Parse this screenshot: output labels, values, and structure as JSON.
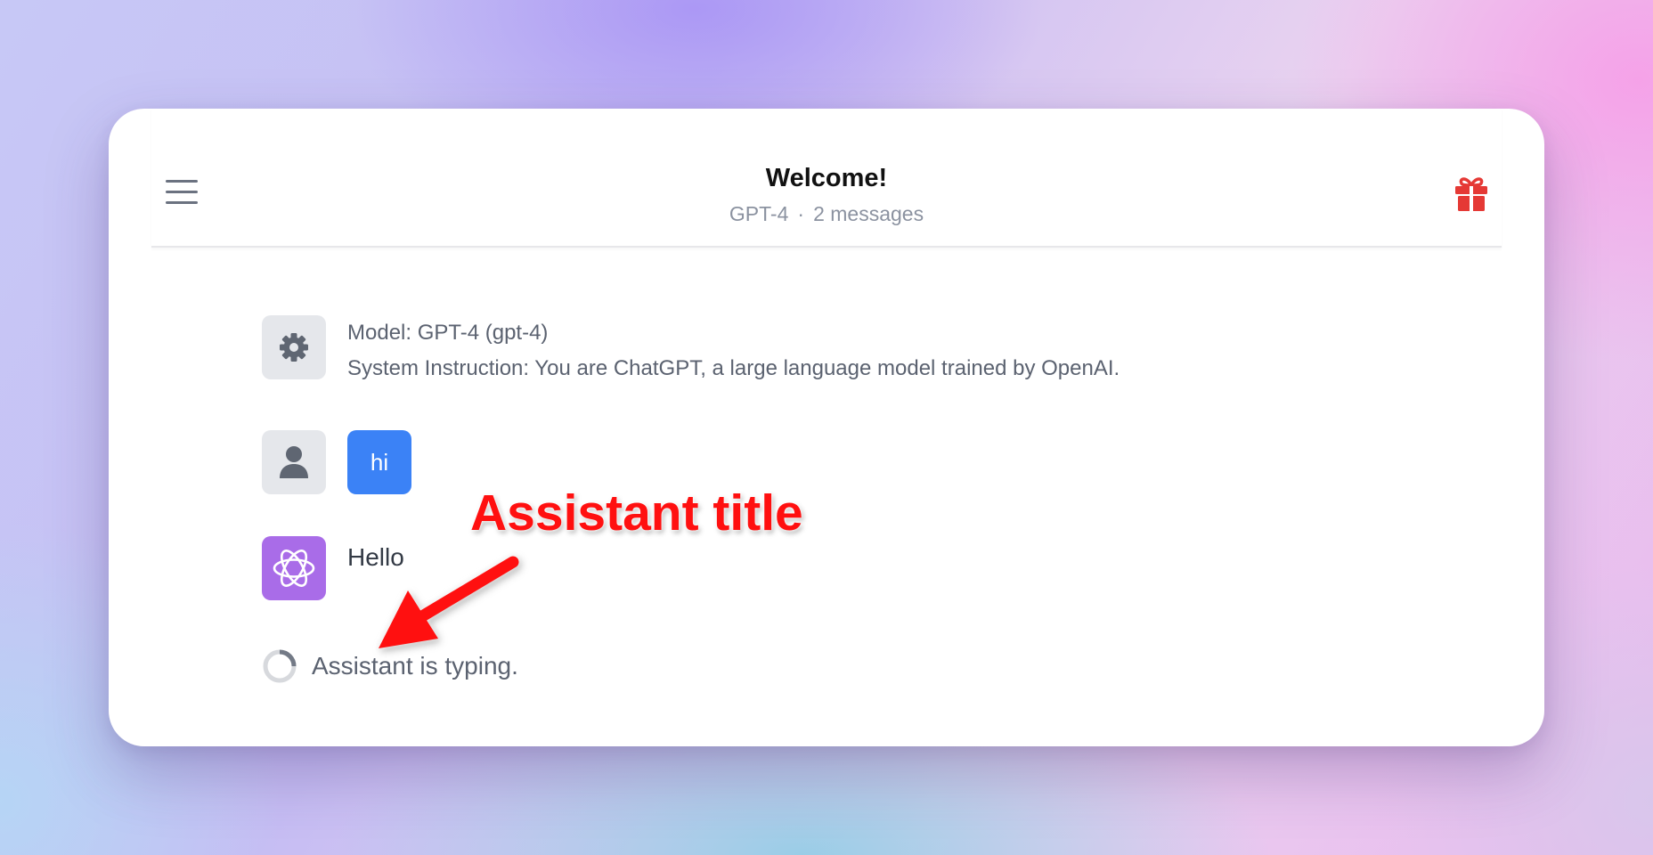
{
  "header": {
    "title": "Welcome!",
    "model": "GPT-4",
    "separator": "·",
    "message_count": "2 messages"
  },
  "icons": {
    "menu": "hamburger-menu-icon",
    "gift": "gift-icon",
    "system": "gear-icon",
    "user": "user-icon",
    "assistant": "openai-logo-icon",
    "loading": "spinner-icon"
  },
  "messages": {
    "system": {
      "model_line": "Model: GPT-4 (gpt-4)",
      "instruction": "System Instruction: You are ChatGPT, a large language model trained by OpenAI."
    },
    "user": {
      "text": "hi"
    },
    "assistant": {
      "text": "Hello"
    },
    "typing": "Assistant is typing."
  },
  "annotation": {
    "label": "Assistant title"
  },
  "colors": {
    "accent_blue": "#3b82f6",
    "assistant_purple": "#a96ce8",
    "gift_red": "#e53935",
    "annotation_red": "#ff1010"
  }
}
